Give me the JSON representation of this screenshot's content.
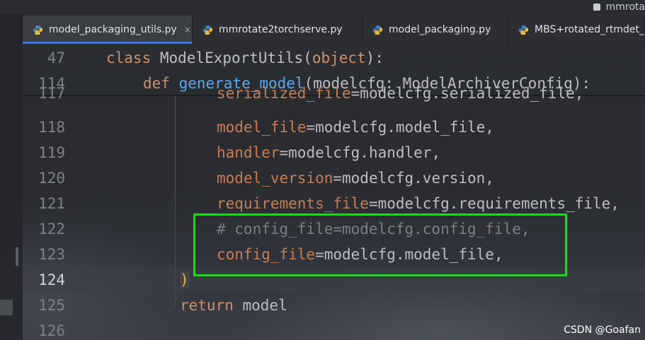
{
  "window": {
    "project_title": "mmrota"
  },
  "tabs": [
    {
      "label": "model_packaging_utils.py",
      "active": true,
      "closable": true,
      "icon": "python-file-icon"
    },
    {
      "label": "mmrotate2torchserve.py",
      "active": false,
      "icon": "python-file-icon"
    },
    {
      "label": "model_packaging.py",
      "active": false,
      "icon": "python-file-icon"
    },
    {
      "label": "MBS+rotated_rtmdet_t",
      "active": false,
      "icon": "python-file-icon"
    }
  ],
  "close_glyph": "×",
  "editor": {
    "sticky_lines": [
      {
        "number": "47",
        "indent": "  ",
        "tokens": {
          "kw": "class",
          "name": " ModelExportUtils",
          "open": "(",
          "arg": "object",
          "close": "):"
        }
      },
      {
        "number": "114",
        "indent": "      ",
        "tokens": {
          "kw": "def",
          "name": " generate_model",
          "open": "(",
          "param": "modelcfg: ModelArchiverConfig",
          "close": "):"
        }
      }
    ],
    "lines": [
      {
        "number": "117",
        "key": "serialized_file",
        "value": "=modelcfg.serialized_file,"
      },
      {
        "number": "118",
        "key": "model_file",
        "value": "=modelcfg.model_file,"
      },
      {
        "number": "119",
        "key": "handler",
        "value": "=modelcfg.handler,"
      },
      {
        "number": "120",
        "key": "model_version",
        "value": "=modelcfg.version,"
      },
      {
        "number": "121",
        "key": "requirements_file",
        "value": "=modelcfg.requirements_file,"
      },
      {
        "number": "122",
        "comment": "# config_file=modelcfg.config_file,"
      },
      {
        "number": "123",
        "key": "config_file",
        "value": "=modelcfg.model_file,"
      },
      {
        "number": "124",
        "text": ")",
        "current": true
      },
      {
        "number": "125",
        "kw": "return",
        "text": " model"
      },
      {
        "number": "126",
        "text": ""
      }
    ]
  },
  "colors": {
    "keyword": "#cf8e6d",
    "function": "#56a8f5",
    "parameter": "#c77d55",
    "highlight_box": "#10e010",
    "active_tab_underline": "#3574f0"
  },
  "watermark": "CSDN @Goafan"
}
